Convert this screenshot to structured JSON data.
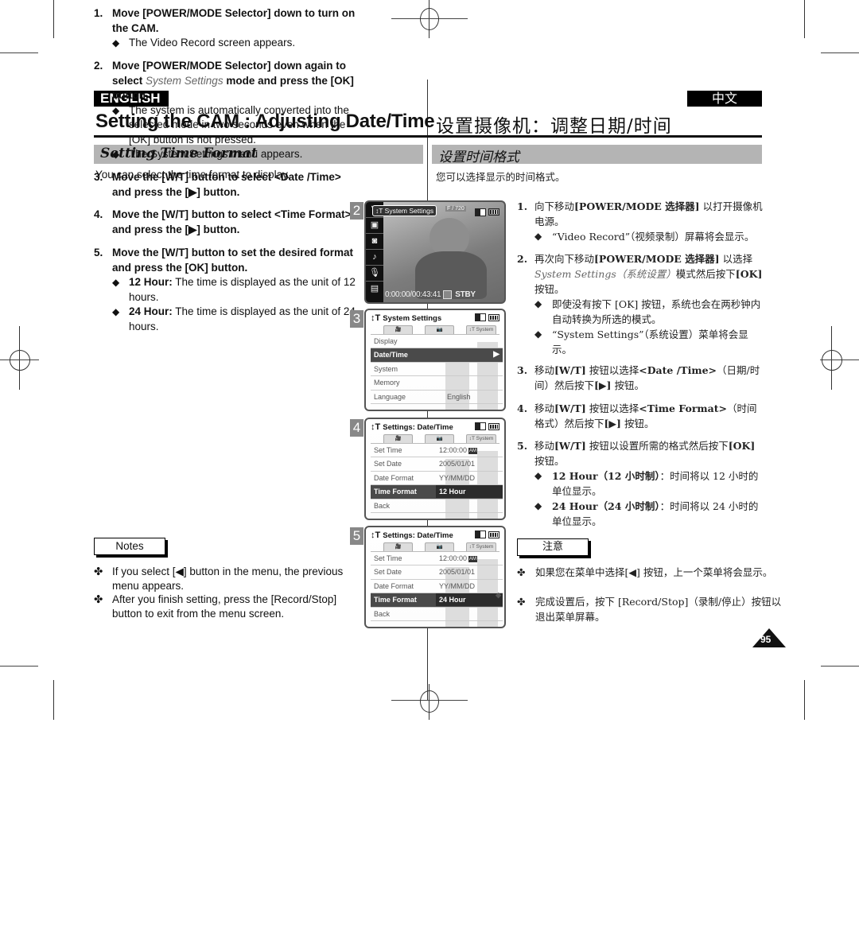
{
  "header": {
    "lang_en": "ENGLISH",
    "lang_zh": "中文",
    "title_en": "Setting the CAM : Adjusting Date/Time",
    "title_zh": "设置摄像机：调整日期/时间"
  },
  "section": {
    "title_en": "Setting Time Format",
    "title_zh": "设置时间格式",
    "intro_en": "You can select the time format to display.",
    "intro_zh": "您可以选择显示的时间格式。"
  },
  "steps_en": [
    {
      "num": "1.",
      "text": "Move [POWER/MODE Selector] down to turn on the CAM.",
      "subs": [
        "The Video Record screen appears."
      ]
    },
    {
      "num": "2.",
      "text_pre": "Move [POWER/MODE Selector] down again to select ",
      "text_ital": "System Settings",
      "text_post": " mode and press the [OK] button.",
      "subs": [
        "The system is automatically converted into the selected mode in two seconds even when the [OK] button is not pressed.",
        "The System Settings menu appears."
      ]
    },
    {
      "num": "3.",
      "text": "Move the [W/T] button to select <Date /Time> and press the [▶] button."
    },
    {
      "num": "4.",
      "text": "Move the [W/T] button to select <Time Format> and press the [▶] button."
    },
    {
      "num": "5.",
      "text": "Move the [W/T] button to set the desired format and press the [OK] button.",
      "subs": [
        {
          "bold": "12 Hour:",
          "rest": " The time is displayed as the unit of 12 hours."
        },
        {
          "bold": "24 Hour:",
          "rest": " The time is displayed as the unit of 24 hours."
        }
      ]
    }
  ],
  "steps_zh": [
    {
      "num": "1.",
      "pre": "向下移动",
      "bold": "[POWER/MODE 选择器]",
      "post": " 以打开摄像机电源。",
      "subs": [
        "“Video Record”（视频录制）屏幕将会显示。"
      ]
    },
    {
      "num": "2.",
      "pre": "再次向下移动",
      "bold": "[POWER/MODE 选择器]",
      "post": " 以选择",
      "ital": "System Settings（系统设置）",
      "post2": "模式然后按下",
      "bold2": "[OK]",
      "post3": "按钮。",
      "subs": [
        "即使没有按下 [OK] 按钮，系统也会在两秒钟内自动转换为所选的模式。",
        "“System Settings”（系统设置）菜单将会显示。"
      ]
    },
    {
      "num": "3.",
      "pre": "移动",
      "bold": "[W/T]",
      "post": " 按钮以选择",
      "bold2": "<Date /Time>",
      "post2": "（日期/时间）然后按下",
      "bold3": "[▶]",
      "post3": " 按钮。"
    },
    {
      "num": "4.",
      "pre": "移动",
      "bold": "[W/T]",
      "post": " 按钮以选择",
      "bold2": "<Time Format>",
      "post2": "（时间格式）然后按下",
      "bold3": "[▶]",
      "post3": " 按钮。"
    },
    {
      "num": "5.",
      "pre": "移动",
      "bold": "[W/T]",
      "post": " 按钮以设置所需的格式然后按下",
      "bold2": "[OK]",
      "post2": " 按钮。",
      "subs": [
        {
          "bold": "12 Hour（12 小时制）",
          "rest": "：时间将以 12 小时的单位显示。"
        },
        {
          "bold": "24 Hour（24 小时制）",
          "rest": "：时间将以 24 小时的单位显示。"
        }
      ]
    }
  ],
  "notes_en": {
    "label": "Notes",
    "items": [
      "If you select [◀] button in the menu, the previous menu appears.",
      "After you finish setting, press the [Record/Stop] button to exit from the menu screen."
    ]
  },
  "notes_zh": {
    "label": "注意",
    "items": [
      "如果您在菜单中选择[◀] 按钮，上一个菜单将会显示。",
      "完成设置后，按下 [Record/Stop]（录制/停止）按钮以退出菜单屏幕。"
    ]
  },
  "bullets": {
    "diamond": "◆",
    "clover": "✤"
  },
  "screens": [
    {
      "num": "2",
      "type": "video",
      "label": "System Settings",
      "resolution": "F / 720",
      "timecode": "0:00:00/00:43:41",
      "status": "STBY",
      "sidebar_icons": [
        "menu-arrow-down-icon",
        "video-camera-icon",
        "camera-icon",
        "music-note-icon",
        "microphone-icon",
        "file-icon"
      ]
    },
    {
      "num": "3",
      "type": "menu",
      "title": "System Settings",
      "tabs": [
        "🎥",
        "📷",
        "↕T System"
      ],
      "rows": [
        {
          "label": "Display",
          "value": ""
        },
        {
          "label": "Date/Time",
          "value": "",
          "selected": true,
          "arrow": "▶"
        },
        {
          "label": "System",
          "value": ""
        },
        {
          "label": "Memory",
          "value": ""
        },
        {
          "label": "Language",
          "value": "English"
        }
      ]
    },
    {
      "num": "4",
      "type": "menu",
      "title": "Settings: Date/Time",
      "tabs": [
        "🎥",
        "📷",
        "↕T System"
      ],
      "rows": [
        {
          "label": "Set Time",
          "value": "12:00:00",
          "badge": "AM"
        },
        {
          "label": "Set Date",
          "value": "2005/01/01"
        },
        {
          "label": "Date Format",
          "value": "YY/MM/DD"
        },
        {
          "label": "Time Format",
          "value": "12 Hour",
          "selected": true
        },
        {
          "label": "Back",
          "value": ""
        }
      ]
    },
    {
      "num": "5",
      "type": "menu",
      "title": "Settings: Date/Time",
      "tabs": [
        "🎥",
        "📷",
        "↕T System"
      ],
      "rows": [
        {
          "label": "Set Time",
          "value": "12:00:00",
          "badge": "AM"
        },
        {
          "label": "Set Date",
          "value": "2005/01/01"
        },
        {
          "label": "Date Format",
          "value": "YY/MM/DD"
        },
        {
          "label": "Time Format",
          "value": "24 Hour",
          "selected": true
        },
        {
          "label": "Back",
          "value": ""
        }
      ]
    }
  ],
  "page_number": "95"
}
